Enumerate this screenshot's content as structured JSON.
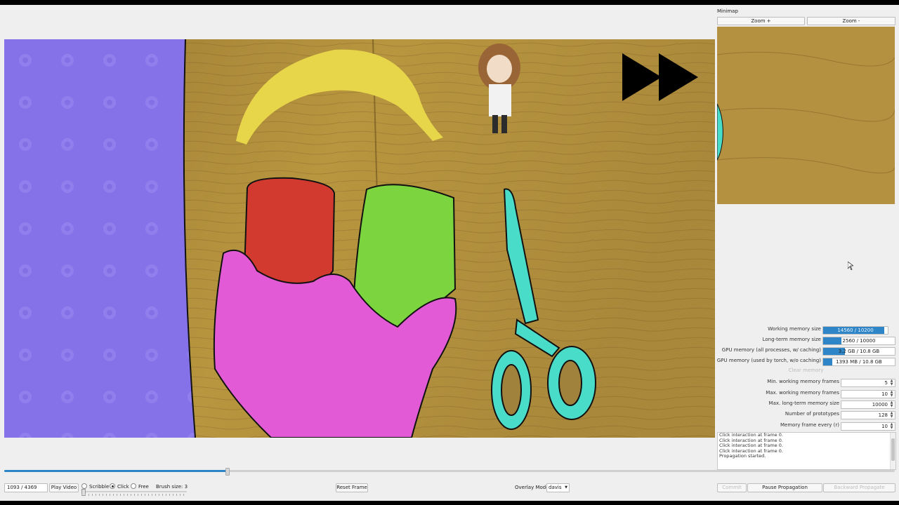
{
  "panel": {
    "title": "Minimap",
    "zoom_in": "Zoom +",
    "zoom_out": "Zoom -"
  },
  "stats": [
    {
      "label": "Working memory size",
      "value": "14560 / 10200",
      "fill": 0.95
    },
    {
      "label": "Long-term memory size",
      "value": "2560 / 10000",
      "fill": 0.256
    },
    {
      "label": "GPU memory (all processes, w/ caching)",
      "value": "3.2 GB / 10.8 GB",
      "fill": 0.3
    },
    {
      "label": "GPU memory (used by torch, w/o caching)",
      "value": "1393 MB / 10.8 GB",
      "fill": 0.13
    }
  ],
  "clear_memory": "Clear memory",
  "settings": [
    {
      "label": "Min. working memory frames",
      "value": "5"
    },
    {
      "label": "Max. working memory frames",
      "value": "10"
    },
    {
      "label": "Max. long-term memory size",
      "value": "10000"
    },
    {
      "label": "Number of prototypes",
      "value": "128"
    },
    {
      "label": "Memory frame every (r)",
      "value": "10"
    }
  ],
  "log": [
    "Click interaction at frame 0.",
    "Click interaction at frame 0.",
    "Click interaction at frame 0.",
    "Click interaction at frame 0.",
    "Propagation started."
  ],
  "timeline": {
    "progress": 0.25
  },
  "controls": {
    "frame_current": "1093",
    "frame_total": "4369",
    "play_video": "Play Video",
    "modes": [
      {
        "label": "Scribble",
        "checked": false
      },
      {
        "label": "Click",
        "checked": true
      },
      {
        "label": "Free",
        "checked": false
      }
    ],
    "brush_size": "Brush size: 3",
    "reset_frame": "Reset Frame",
    "overlay_label": "Overlay Mode",
    "overlay_value": "davis",
    "commit": "Commit",
    "pause_propagation": "Pause Propagation",
    "backward_propagate": "Backward Propagate"
  },
  "colors": {
    "accent": "#2e86c9",
    "mask_towel": "#8572e8",
    "mask_can_red": "#d23a30",
    "mask_can_green": "#7cd43f",
    "mask_hand": "#e35ad6",
    "mask_scissors": "#49dcc9"
  }
}
